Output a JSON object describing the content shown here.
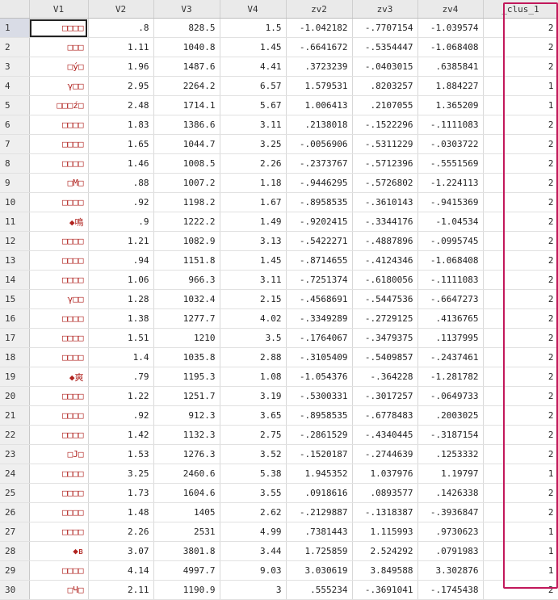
{
  "columns": [
    "V1",
    "V2",
    "V3",
    "V4",
    "zv2",
    "zv3",
    "zv4",
    "_clus_1"
  ],
  "rows": [
    {
      "n": "1",
      "v1": "□□□□",
      "v2": ".8",
      "v3": "828.5",
      "v4": "1.5",
      "zv2": "-1.042182",
      "zv3": "-.7707154",
      "zv4": "-1.039574",
      "c": "2"
    },
    {
      "n": "2",
      "v1": "□□□",
      "v2": "1.11",
      "v3": "1040.8",
      "v4": "1.45",
      "zv2": "-.6641672",
      "zv3": "-.5354447",
      "zv4": "-1.068408",
      "c": "2"
    },
    {
      "n": "3",
      "v1": "□ý□",
      "v2": "1.96",
      "v3": "1487.6",
      "v4": "4.41",
      "zv2": ".3723239",
      "zv3": "-.0403015",
      "zv4": ".6385841",
      "c": "2"
    },
    {
      "n": "4",
      "v1": "γ□□",
      "v2": "2.95",
      "v3": "2264.2",
      "v4": "6.57",
      "zv2": "1.579531",
      "zv3": ".8203257",
      "zv4": "1.884227",
      "c": "1"
    },
    {
      "n": "5",
      "v1": "□□□ź□",
      "v2": "2.48",
      "v3": "1714.1",
      "v4": "5.67",
      "zv2": "1.006413",
      "zv3": ".2107055",
      "zv4": "1.365209",
      "c": "1"
    },
    {
      "n": "6",
      "v1": "□□□□",
      "v2": "1.83",
      "v3": "1386.6",
      "v4": "3.11",
      "zv2": ".2138018",
      "zv3": "-.1522296",
      "zv4": "-.1111083",
      "c": "2"
    },
    {
      "n": "7",
      "v1": "□□□□",
      "v2": "1.65",
      "v3": "1044.7",
      "v4": "3.25",
      "zv2": "-.0056906",
      "zv3": "-.5311229",
      "zv4": "-.0303722",
      "c": "2"
    },
    {
      "n": "8",
      "v1": "□□□□",
      "v2": "1.46",
      "v3": "1008.5",
      "v4": "2.26",
      "zv2": "-.2373767",
      "zv3": "-.5712396",
      "zv4": "-.5551569",
      "c": "2"
    },
    {
      "n": "9",
      "v1": "□M□",
      "v2": ".88",
      "v3": "1007.2",
      "v4": "1.18",
      "zv2": "-.9446295",
      "zv3": "-.5726802",
      "zv4": "-1.224113",
      "c": "2"
    },
    {
      "n": "10",
      "v1": "□□□□",
      "v2": ".92",
      "v3": "1198.2",
      "v4": "1.67",
      "zv2": "-.8958535",
      "zv3": "-.3610143",
      "zv4": "-.9415369",
      "c": "2"
    },
    {
      "n": "11",
      "v1": "◆鳴",
      "v2": ".9",
      "v3": "1222.2",
      "v4": "1.49",
      "zv2": "-.9202415",
      "zv3": "-.3344176",
      "zv4": "-1.04534",
      "c": "2"
    },
    {
      "n": "12",
      "v1": "□□□□",
      "v2": "1.21",
      "v3": "1082.9",
      "v4": "3.13",
      "zv2": "-.5422271",
      "zv3": "-.4887896",
      "zv4": "-.0995745",
      "c": "2"
    },
    {
      "n": "13",
      "v1": "□□□□",
      "v2": ".94",
      "v3": "1151.8",
      "v4": "1.45",
      "zv2": "-.8714655",
      "zv3": "-.4124346",
      "zv4": "-1.068408",
      "c": "2"
    },
    {
      "n": "14",
      "v1": "□□□□",
      "v2": "1.06",
      "v3": "966.3",
      "v4": "3.11",
      "zv2": "-.7251374",
      "zv3": "-.6180056",
      "zv4": "-.1111083",
      "c": "2"
    },
    {
      "n": "15",
      "v1": "γ□□",
      "v2": "1.28",
      "v3": "1032.4",
      "v4": "2.15",
      "zv2": "-.4568691",
      "zv3": "-.5447536",
      "zv4": "-.6647273",
      "c": "2"
    },
    {
      "n": "16",
      "v1": "□□□□",
      "v2": "1.38",
      "v3": "1277.7",
      "v4": "4.02",
      "zv2": "-.3349289",
      "zv3": "-.2729125",
      "zv4": ".4136765",
      "c": "2"
    },
    {
      "n": "17",
      "v1": "□□□□",
      "v2": "1.51",
      "v3": "1210",
      "v4": "3.5",
      "zv2": "-.1764067",
      "zv3": "-.3479375",
      "zv4": ".1137995",
      "c": "2"
    },
    {
      "n": "18",
      "v1": "□□□□",
      "v2": "1.4",
      "v3": "1035.8",
      "v4": "2.88",
      "zv2": "-.3105409",
      "zv3": "-.5409857",
      "zv4": "-.2437461",
      "c": "2"
    },
    {
      "n": "19",
      "v1": "◆爽",
      "v2": ".79",
      "v3": "1195.3",
      "v4": "1.08",
      "zv2": "-1.054376",
      "zv3": "-.364228",
      "zv4": "-1.281782",
      "c": "2"
    },
    {
      "n": "20",
      "v1": "□□□□",
      "v2": "1.22",
      "v3": "1251.7",
      "v4": "3.19",
      "zv2": "-.5300331",
      "zv3": "-.3017257",
      "zv4": "-.0649733",
      "c": "2"
    },
    {
      "n": "21",
      "v1": "□□□□",
      "v2": ".92",
      "v3": "912.3",
      "v4": "3.65",
      "zv2": "-.8958535",
      "zv3": "-.6778483",
      "zv4": ".2003025",
      "c": "2"
    },
    {
      "n": "22",
      "v1": "□□□□",
      "v2": "1.42",
      "v3": "1132.3",
      "v4": "2.75",
      "zv2": "-.2861529",
      "zv3": "-.4340445",
      "zv4": "-.3187154",
      "c": "2"
    },
    {
      "n": "23",
      "v1": "□J□",
      "v2": "1.53",
      "v3": "1276.3",
      "v4": "3.52",
      "zv2": "-.1520187",
      "zv3": "-.2744639",
      "zv4": ".1253332",
      "c": "2"
    },
    {
      "n": "24",
      "v1": "□□□□",
      "v2": "3.25",
      "v3": "2460.6",
      "v4": "5.38",
      "zv2": "1.945352",
      "zv3": "1.037976",
      "zv4": "1.19797",
      "c": "1"
    },
    {
      "n": "25",
      "v1": "□□□□",
      "v2": "1.73",
      "v3": "1604.6",
      "v4": "3.55",
      "zv2": ".0918616",
      "zv3": ".0893577",
      "zv4": ".1426338",
      "c": "2"
    },
    {
      "n": "26",
      "v1": "□□□□",
      "v2": "1.48",
      "v3": "1405",
      "v4": "2.62",
      "zv2": "-.2129887",
      "zv3": "-.1318387",
      "zv4": "-.3936847",
      "c": "2"
    },
    {
      "n": "27",
      "v1": "□□□□",
      "v2": "2.26",
      "v3": "2531",
      "v4": "4.99",
      "zv2": ".7381443",
      "zv3": "1.115993",
      "zv4": ".9730623",
      "c": "1"
    },
    {
      "n": "28",
      "v1": "◆ʙ",
      "v2": "3.07",
      "v3": "3801.8",
      "v4": "3.44",
      "zv2": "1.725859",
      "zv3": "2.524292",
      "zv4": ".0791983",
      "c": "1"
    },
    {
      "n": "29",
      "v1": "□□□□",
      "v2": "4.14",
      "v3": "4997.7",
      "v4": "9.03",
      "zv2": "3.030619",
      "zv3": "3.849588",
      "zv4": "3.302876",
      "c": "1"
    },
    {
      "n": "30",
      "v1": "□Ч□",
      "v2": "2.11",
      "v3": "1190.9",
      "v4": "3",
      "zv2": ".555234",
      "zv3": "-.3691041",
      "zv4": "-.1745438",
      "c": "2"
    }
  ],
  "colors": {
    "string_text": "#b0231f",
    "highlight_border": "#c2185b",
    "header_bg": "#eaeaea"
  }
}
